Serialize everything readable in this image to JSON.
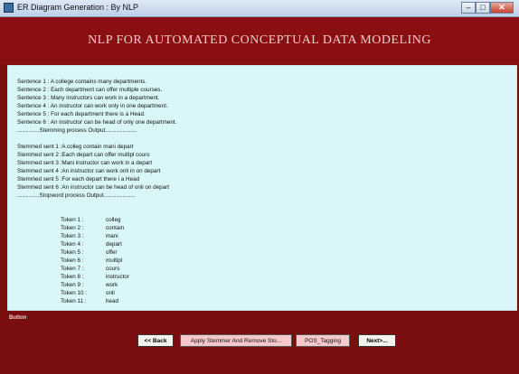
{
  "window": {
    "title": "ER Diagram Generation : By NLP"
  },
  "header": {
    "title": "NLP FOR AUTOMATED CONCEPTUAL DATA MODELING"
  },
  "output": {
    "sentences": [
      "Sentence 1 : A college contains many departments.",
      "Sentence 2 : Each department can offer multiple courses.",
      "Sentence 3 : Many instructors can work in a department.",
      "Sentence 4 : An instructor can work only in one department.",
      "Sentence 5 : For each department there is a Head.",
      "Sentence 6 : An instructor can be head of only one department."
    ],
    "stemming_header": "..............Stemming  process Output....................",
    "stemmed": [
      "Stemmed sent  1 :A colleg contain mani depart",
      "Stemmed sent  2 :Each depart can offer multipl cours",
      "Stemmed sent  3 :Mani instructor can work in a depart",
      "Stemmed sent  4 :An instructor can work onli in on depart",
      "Stemmed sent  5 :For each depart there i a Head",
      "Stemmed sent  6 :An instructor can be head of onli on depart"
    ],
    "stopword_header": "..............Stopword process Output....................",
    "tokens": [
      {
        "label": "Token 1 :",
        "value": "colleg"
      },
      {
        "label": "Token 2 :",
        "value": "contain"
      },
      {
        "label": "Token 3 :",
        "value": "mani"
      },
      {
        "label": "Token 4 :",
        "value": "depart"
      },
      {
        "label": "Token 5 :",
        "value": "offer"
      },
      {
        "label": "Token 6 :",
        "value": "multipl"
      },
      {
        "label": "Token 7 :",
        "value": "cours"
      },
      {
        "label": "Token 8 :",
        "value": "instructor"
      },
      {
        "label": "Token 9 :",
        "value": "work"
      },
      {
        "label": "Token 10 :",
        "value": "onli"
      },
      {
        "label": "Token 11 :",
        "value": "head"
      }
    ]
  },
  "footer": {
    "section_label": "Button",
    "buttons": {
      "back": "<< Back",
      "stem": "Apply Stemmer And Remove Sto...",
      "pos": "POS_Tagging",
      "next": "Next>..."
    }
  }
}
